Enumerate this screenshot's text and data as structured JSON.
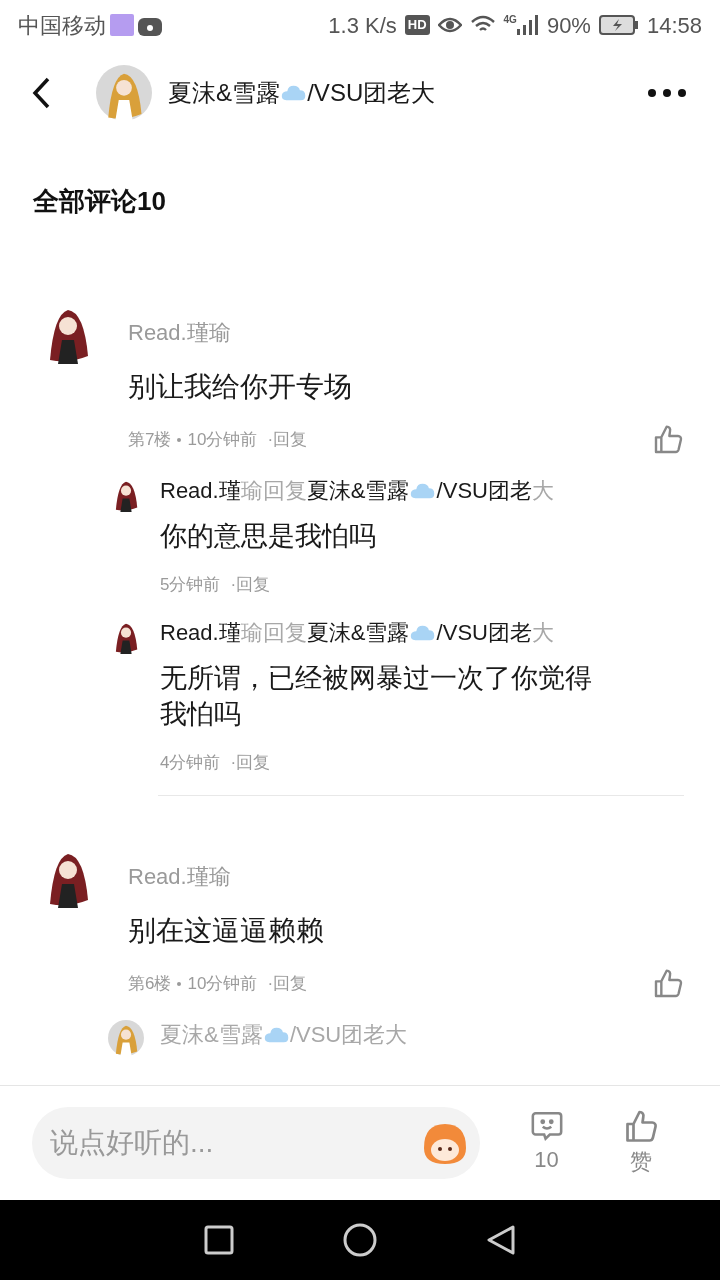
{
  "status_bar": {
    "carrier": "中国移动",
    "speed": "1.3 K/s",
    "hd": "HD",
    "network": "4G",
    "battery": "90%",
    "time": "14:58"
  },
  "header": {
    "title": [
      {
        "kind": "text",
        "text": "夏沫&雪露",
        "muted": false
      },
      {
        "kind": "cloud"
      },
      {
        "kind": "text",
        "text": "/VSU团老大",
        "muted": false
      }
    ]
  },
  "heading": "全部评论10",
  "comments": [
    {
      "author": "Read.瑾瑜",
      "text": "别让我给你开专场",
      "floor": "第7楼",
      "time": "10分钟前",
      "reply_label": "·回复",
      "replies": [
        {
          "name": [
            {
              "kind": "text",
              "text": "Read.瑾",
              "muted": false
            },
            {
              "kind": "text",
              "text": "瑜回复",
              "muted": true
            },
            {
              "kind": "text",
              "text": "夏沫&雪露",
              "muted": false
            },
            {
              "kind": "cloud"
            },
            {
              "kind": "text",
              "text": "/VSU团老",
              "muted": false
            },
            {
              "kind": "text",
              "text": "大",
              "muted": true
            }
          ],
          "kind": "dark",
          "text": "你的意思是我怕吗",
          "time": "5分钟前",
          "reply_label": "·回复"
        },
        {
          "name": [
            {
              "kind": "text",
              "text": "Read.瑾",
              "muted": false
            },
            {
              "kind": "text",
              "text": "瑜回复",
              "muted": true
            },
            {
              "kind": "text",
              "text": "夏沫&雪露",
              "muted": false
            },
            {
              "kind": "cloud"
            },
            {
              "kind": "text",
              "text": "/VSU团老",
              "muted": false
            },
            {
              "kind": "text",
              "text": "大",
              "muted": true
            }
          ],
          "kind": "dark",
          "text": "无所谓，已经被网暴过一次了你觉得我怕吗",
          "time": "4分钟前",
          "reply_label": "·回复"
        }
      ]
    },
    {
      "author": "Read.瑾瑜",
      "text": "别在这逼逼赖赖",
      "floor": "第6楼",
      "time": "10分钟前",
      "reply_label": "·回复",
      "replies": [
        {
          "name": [
            {
              "kind": "text",
              "text": "夏沫&雪露",
              "muted": true
            },
            {
              "kind": "cloud"
            },
            {
              "kind": "text",
              "text": "/VSU团老大",
              "muted": true
            }
          ],
          "kind": "blonde"
        }
      ]
    }
  ],
  "bottom_bar": {
    "placeholder": "说点好听的...",
    "comment_count": "10",
    "like_label": "赞"
  }
}
